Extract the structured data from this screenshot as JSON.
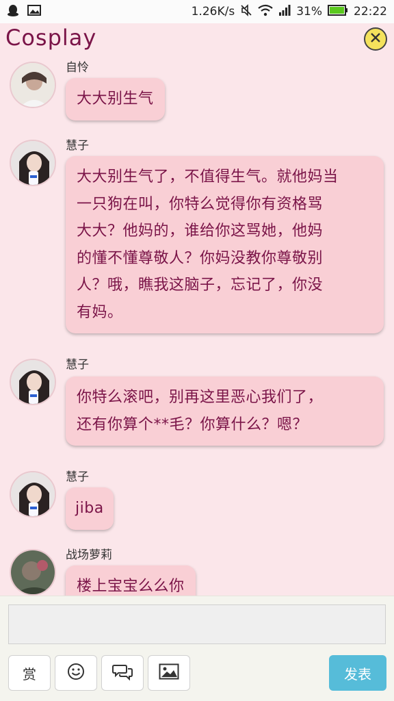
{
  "status_bar": {
    "network_speed": "1.26K/s",
    "battery_percent": "31%",
    "time": "22:22",
    "icons": [
      "qq-icon",
      "image-icon",
      "mute-icon",
      "wifi-icon",
      "signal-icon",
      "battery-icon"
    ]
  },
  "header": {
    "title": "Cosplay",
    "close_icon": "close-icon"
  },
  "messages": [
    {
      "user": "自怜",
      "text": "大大别生气"
    },
    {
      "user": "慧子",
      "lines": [
        "大大别生气了，不值得生气。就他妈当",
        "一只狗在叫，你特么觉得你有资格骂",
        "大大？他妈的，谁给你这骂她，他妈",
        "的懂不懂尊敬人？你妈没教你尊敬别",
        "人？哦，瞧我这脑子，忘记了，你没",
        "有妈。"
      ]
    },
    {
      "user": "慧子",
      "lines": [
        "你特么滚吧，别再这里恶心我们了，",
        "还有你算个**毛？你算什么？嗯？"
      ]
    },
    {
      "user": "慧子",
      "text": "jiba"
    },
    {
      "user": "战场萝莉",
      "text": "楼上宝宝么么你"
    }
  ],
  "input_bar": {
    "reward_label": "赏",
    "emoji_icon": "smiley-icon",
    "chat_icon": "chat-bubbles-icon",
    "image_icon": "picture-icon",
    "send_label": "发表"
  },
  "colors": {
    "background": "#fbe6ea",
    "bubble": "#f9cfd5",
    "text": "#7a1448",
    "send_button": "#56bcd9",
    "close_button": "#f4e25c"
  }
}
